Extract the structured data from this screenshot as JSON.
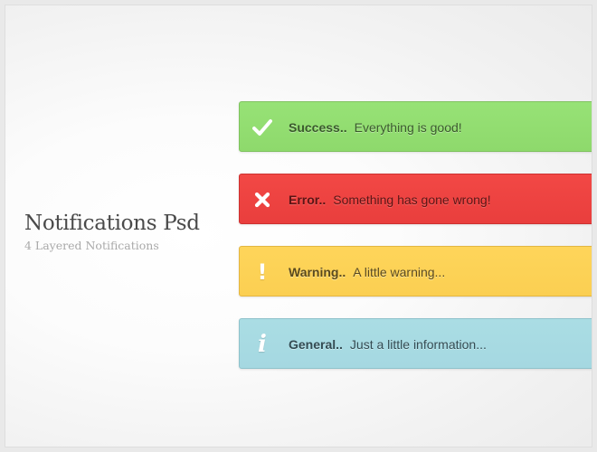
{
  "header": {
    "title": "Notifications Psd",
    "subtitle": "4 Layered Notifications"
  },
  "notifications": [
    {
      "type": "success",
      "icon": "checkmark-icon",
      "label": "Success..",
      "message": "Everything is good!",
      "color": "#95df73"
    },
    {
      "type": "error",
      "icon": "close-icon",
      "label": "Error..",
      "message": "Something has gone wrong!",
      "color": "#f04443"
    },
    {
      "type": "warning",
      "icon": "exclamation-icon",
      "label": "Warning..",
      "message": "A little warning...",
      "color": "#fdd356"
    },
    {
      "type": "general",
      "icon": "info-icon",
      "label": "General..",
      "message": "Just a little information...",
      "color": "#a8dbe2"
    }
  ]
}
